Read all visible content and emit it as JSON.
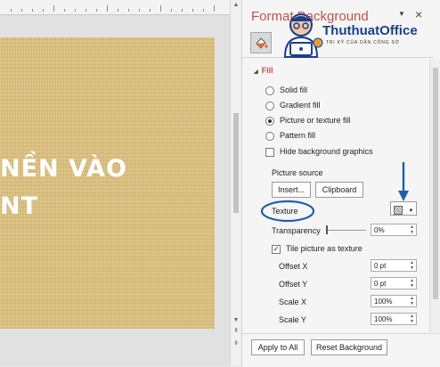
{
  "slide": {
    "line1": "NỀN VÀO",
    "line2": "NT"
  },
  "pane": {
    "title": "Format Background",
    "close": "×",
    "section_fill": "Fill",
    "fill_options": [
      "Solid fill",
      "Gradient fill",
      "Picture or texture fill",
      "Pattern fill"
    ],
    "selected_fill": "Picture or texture fill",
    "hide_bg_label": "Hide background graphics",
    "picture_source_label": "Picture source",
    "insert_button": "Insert...",
    "clipboard_button": "Clipboard",
    "texture_label": "Texture",
    "transparency_label": "Transparency",
    "transparency_value": "0%",
    "tile_label": "Tile picture as texture",
    "tile_checked": true,
    "offset_x_label": "Offset X",
    "offset_x_value": "0 pt",
    "offset_y_label": "Offset Y",
    "offset_y_value": "0 pt",
    "scale_x_label": "Scale X",
    "scale_x_value": "100%",
    "scale_y_label": "Scale Y",
    "scale_y_value": "100%",
    "apply_all_button": "Apply to All",
    "reset_button": "Reset Background"
  },
  "logo": {
    "title": "ThuthuatOffice",
    "subtitle": "TRI KỶ CỦA DÂN CÔNG SỞ"
  },
  "colors": {
    "title_red": "#c0504d",
    "annotation_blue": "#1f5fa8",
    "slide_texture": "#dcc07d"
  }
}
